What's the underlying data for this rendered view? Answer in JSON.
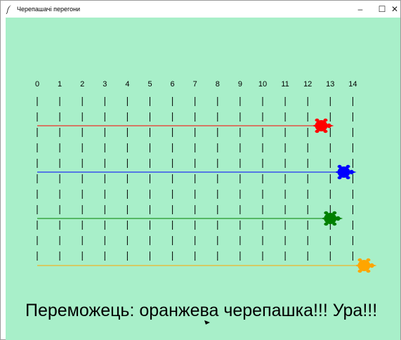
{
  "window": {
    "title": "Черепашачі перегони",
    "icon": "feather-icon",
    "controls": {
      "minimize": "–",
      "maximize": "☐",
      "close": "✕"
    }
  },
  "race": {
    "background_color": "#a8efc9",
    "track_labels": [
      "0",
      "1",
      "2",
      "3",
      "4",
      "5",
      "6",
      "7",
      "8",
      "9",
      "10",
      "11",
      "12",
      "13",
      "14"
    ],
    "turtles": [
      {
        "name": "red",
        "color": "#ff0000",
        "position": 12.6
      },
      {
        "name": "blue",
        "color": "#0000ff",
        "position": 13.6
      },
      {
        "name": "green",
        "color": "#008000",
        "position": 13.0
      },
      {
        "name": "orange",
        "color": "#ffa500",
        "position": 14.5
      }
    ],
    "winner_text": "Переможець: оранжева черепашка!!! Ура!!!"
  }
}
